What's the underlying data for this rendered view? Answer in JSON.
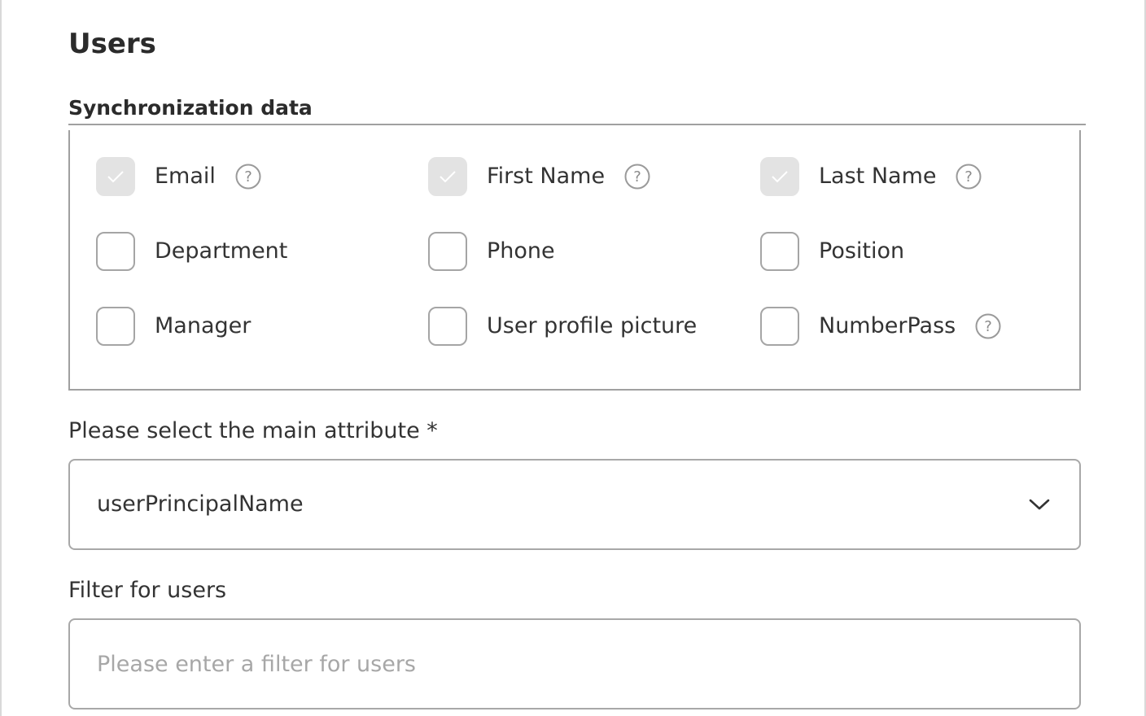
{
  "page": {
    "title": "Users"
  },
  "sync_section": {
    "title": "Synchronization data",
    "checkboxes": [
      {
        "label": "Email",
        "checked": true,
        "disabled": true,
        "has_help": true,
        "help_icon": "question-circle-icon"
      },
      {
        "label": "First Name",
        "checked": true,
        "disabled": true,
        "has_help": true,
        "help_icon": "question-circle-icon"
      },
      {
        "label": "Last Name",
        "checked": true,
        "disabled": true,
        "has_help": true,
        "help_icon": "question-circle-icon"
      },
      {
        "label": "Department",
        "checked": false,
        "disabled": false,
        "has_help": false
      },
      {
        "label": "Phone",
        "checked": false,
        "disabled": false,
        "has_help": false
      },
      {
        "label": "Position",
        "checked": false,
        "disabled": false,
        "has_help": false
      },
      {
        "label": "Manager",
        "checked": false,
        "disabled": false,
        "has_help": false
      },
      {
        "label": "User profile picture",
        "checked": false,
        "disabled": false,
        "has_help": false
      },
      {
        "label": "NumberPass",
        "checked": false,
        "disabled": false,
        "has_help": true,
        "help_icon": "question-circle-icon"
      }
    ]
  },
  "main_attribute": {
    "label": "Please select the main attribute *",
    "selected_value": "userPrincipalName",
    "icon": "chevron-down-icon"
  },
  "user_filter": {
    "label": "Filter for users",
    "value": "",
    "placeholder": "Please enter a filter for users"
  },
  "colors": {
    "text": "#333333",
    "border": "#a8a8a8",
    "checked_bg": "#e3e3e3",
    "placeholder": "#a7a7a7"
  }
}
